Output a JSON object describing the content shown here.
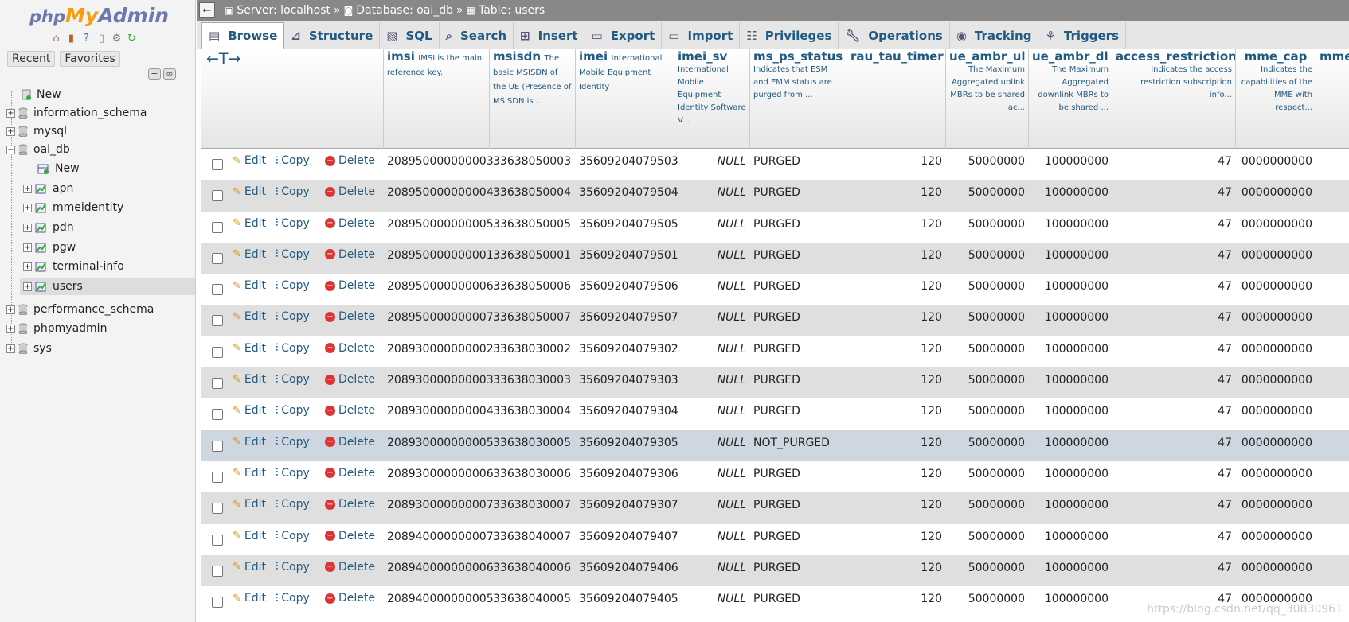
{
  "sidebar": {
    "logo_php": "php",
    "logo_my": "My",
    "logo_admin": "Admin",
    "recent": "Recent",
    "favorites": "Favorites",
    "tree": {
      "new_root": "New",
      "information_schema": "information_schema",
      "mysql": "mysql",
      "oai_db": "oai_db",
      "new_table": "New",
      "apn": "apn",
      "mmeidentity": "mmeidentity",
      "pdn": "pdn",
      "pgw": "pgw",
      "terminal_info": "terminal-info",
      "users": "users",
      "performance_schema": "performance_schema",
      "phpmyadmin": "phpmyadmin",
      "sys": "sys"
    }
  },
  "breadcrumb": {
    "server": "Server: localhost",
    "database": "Database: oai_db",
    "table": "Table: users",
    "sep": "»"
  },
  "tabs": [
    "Browse",
    "Structure",
    "SQL",
    "Search",
    "Insert",
    "Export",
    "Import",
    "Privileges",
    "Operations",
    "Tracking",
    "Triggers"
  ],
  "table": {
    "arrows": "←T→",
    "columns": [
      {
        "name": "imsi",
        "comment": "IMSI is the main reference key."
      },
      {
        "name": "msisdn",
        "comment": "The basic MSISDN of the UE (Presence of MSISDN is ..."
      },
      {
        "name": "imei",
        "comment": "International Mobile Equipment Identity"
      },
      {
        "name": "imei_sv",
        "comment": "International Mobile Equipment Identity Software V..."
      },
      {
        "name": "ms_ps_status",
        "comment": "Indicates that ESM and EMM status are purged from ..."
      },
      {
        "name": "rau_tau_timer",
        "comment": ""
      },
      {
        "name": "ue_ambr_ul",
        "comment": "The Maximum Aggregated uplink MBRs to be shared ac..."
      },
      {
        "name": "ue_ambr_dl",
        "comment": "The Maximum Aggregated downlink MBRs to be shared ..."
      },
      {
        "name": "access_restriction",
        "comment": "Indicates the access restriction subscription info..."
      },
      {
        "name": "mme_cap",
        "comment": "Indicates the capabilities of the MME with respect..."
      },
      {
        "name": "mme",
        "comment": ""
      }
    ],
    "actions": {
      "edit": "Edit",
      "copy": "Copy",
      "delete": "Delete"
    },
    "rows": [
      {
        "imsi": "208950000000003",
        "msisdn": "33638050003",
        "imei": "35609204079503",
        "imei_sv": "NULL",
        "status": "PURGED",
        "rau": "120",
        "ul": "50000000",
        "dl": "100000000",
        "access": "47",
        "cap": "0000000000"
      },
      {
        "imsi": "208950000000004",
        "msisdn": "33638050004",
        "imei": "35609204079504",
        "imei_sv": "NULL",
        "status": "PURGED",
        "rau": "120",
        "ul": "50000000",
        "dl": "100000000",
        "access": "47",
        "cap": "0000000000"
      },
      {
        "imsi": "208950000000005",
        "msisdn": "33638050005",
        "imei": "35609204079505",
        "imei_sv": "NULL",
        "status": "PURGED",
        "rau": "120",
        "ul": "50000000",
        "dl": "100000000",
        "access": "47",
        "cap": "0000000000"
      },
      {
        "imsi": "208950000000001",
        "msisdn": "33638050001",
        "imei": "35609204079501",
        "imei_sv": "NULL",
        "status": "PURGED",
        "rau": "120",
        "ul": "50000000",
        "dl": "100000000",
        "access": "47",
        "cap": "0000000000"
      },
      {
        "imsi": "208950000000006",
        "msisdn": "33638050006",
        "imei": "35609204079506",
        "imei_sv": "NULL",
        "status": "PURGED",
        "rau": "120",
        "ul": "50000000",
        "dl": "100000000",
        "access": "47",
        "cap": "0000000000"
      },
      {
        "imsi": "208950000000007",
        "msisdn": "33638050007",
        "imei": "35609204079507",
        "imei_sv": "NULL",
        "status": "PURGED",
        "rau": "120",
        "ul": "50000000",
        "dl": "100000000",
        "access": "47",
        "cap": "0000000000"
      },
      {
        "imsi": "208930000000002",
        "msisdn": "33638030002",
        "imei": "35609204079302",
        "imei_sv": "NULL",
        "status": "PURGED",
        "rau": "120",
        "ul": "50000000",
        "dl": "100000000",
        "access": "47",
        "cap": "0000000000"
      },
      {
        "imsi": "208930000000003",
        "msisdn": "33638030003",
        "imei": "35609204079303",
        "imei_sv": "NULL",
        "status": "PURGED",
        "rau": "120",
        "ul": "50000000",
        "dl": "100000000",
        "access": "47",
        "cap": "0000000000"
      },
      {
        "imsi": "208930000000004",
        "msisdn": "33638030004",
        "imei": "35609204079304",
        "imei_sv": "NULL",
        "status": "PURGED",
        "rau": "120",
        "ul": "50000000",
        "dl": "100000000",
        "access": "47",
        "cap": "0000000000"
      },
      {
        "imsi": "208930000000005",
        "msisdn": "33638030005",
        "imei": "35609204079305",
        "imei_sv": "NULL",
        "status": "NOT_PURGED",
        "rau": "120",
        "ul": "50000000",
        "dl": "100000000",
        "access": "47",
        "cap": "0000000000",
        "marked": true
      },
      {
        "imsi": "208930000000006",
        "msisdn": "33638030006",
        "imei": "35609204079306",
        "imei_sv": "NULL",
        "status": "PURGED",
        "rau": "120",
        "ul": "50000000",
        "dl": "100000000",
        "access": "47",
        "cap": "0000000000"
      },
      {
        "imsi": "208930000000007",
        "msisdn": "33638030007",
        "imei": "35609204079307",
        "imei_sv": "NULL",
        "status": "PURGED",
        "rau": "120",
        "ul": "50000000",
        "dl": "100000000",
        "access": "47",
        "cap": "0000000000"
      },
      {
        "imsi": "208940000000007",
        "msisdn": "33638040007",
        "imei": "35609204079407",
        "imei_sv": "NULL",
        "status": "PURGED",
        "rau": "120",
        "ul": "50000000",
        "dl": "100000000",
        "access": "47",
        "cap": "0000000000"
      },
      {
        "imsi": "208940000000006",
        "msisdn": "33638040006",
        "imei": "35609204079406",
        "imei_sv": "NULL",
        "status": "PURGED",
        "rau": "120",
        "ul": "50000000",
        "dl": "100000000",
        "access": "47",
        "cap": "0000000000"
      },
      {
        "imsi": "208940000000005",
        "msisdn": "33638040005",
        "imei": "35609204079405",
        "imei_sv": "NULL",
        "status": "PURGED",
        "rau": "120",
        "ul": "50000000",
        "dl": "100000000",
        "access": "47",
        "cap": "0000000000"
      }
    ]
  },
  "watermark": "https://blog.csdn.net/qq_30830961",
  "colors": {
    "link": "#235a81",
    "row_even": "#dfdfdf",
    "row_marked": "#ced6df",
    "topbar": "#888888"
  }
}
